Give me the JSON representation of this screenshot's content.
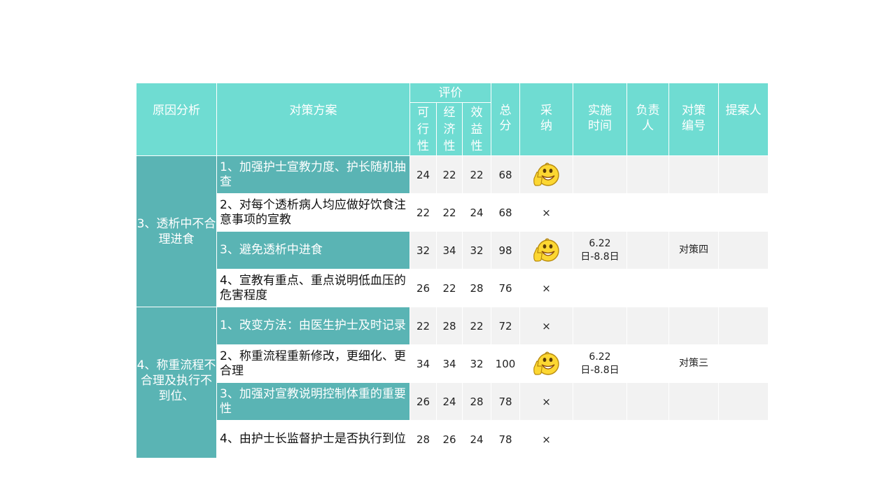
{
  "header": {
    "cause": "原因分析",
    "plan": "对策方案",
    "evaluation": "评价",
    "feasibility": [
      "可",
      "行",
      "性"
    ],
    "economy": [
      "经",
      "济",
      "性"
    ],
    "benefit": [
      "效",
      "益",
      "性"
    ],
    "total": [
      "总",
      "分"
    ],
    "adopt": [
      "采",
      "纳"
    ],
    "time": [
      "实施",
      "时间"
    ],
    "owner": [
      "负责",
      "人"
    ],
    "code": [
      "对策",
      "编号"
    ],
    "proposer": "提案人"
  },
  "causes": [
    {
      "label": "3、透析中不合理进食"
    },
    {
      "label": "4、称重流程不合理及执行不到位、"
    }
  ],
  "rows": [
    {
      "plan": "1、加强护士宣教力度、护长随机抽查",
      "feasibility": "24",
      "economy": "22",
      "benefit": "22",
      "total": "68",
      "adopted": true,
      "adopt_mark": "",
      "time": "",
      "owner": "",
      "code": "",
      "proposer": ""
    },
    {
      "plan": "2、对每个透析病人均应做好饮食注意事项的宣教",
      "feasibility": "22",
      "economy": "22",
      "benefit": "24",
      "total": "68",
      "adopted": false,
      "adopt_mark": "×",
      "time": "",
      "owner": "",
      "code": "",
      "proposer": ""
    },
    {
      "plan": "3、避免透析中进食",
      "feasibility": "32",
      "economy": "34",
      "benefit": "32",
      "total": "98",
      "adopted": true,
      "adopt_mark": "",
      "time": "6.22日-8.8日",
      "owner": "",
      "code": "对策四",
      "proposer": ""
    },
    {
      "plan": "4、宣教有重点、重点说明低血压的危害程度",
      "feasibility": "26",
      "economy": "22",
      "benefit": "28",
      "total": "76",
      "adopted": false,
      "adopt_mark": "×",
      "time": "",
      "owner": "",
      "code": "",
      "proposer": ""
    },
    {
      "plan": "1、改变方法：由医生护士及时记录",
      "feasibility": "22",
      "economy": "28",
      "benefit": "22",
      "total": "72",
      "adopted": false,
      "adopt_mark": "×",
      "time": "",
      "owner": "",
      "code": "",
      "proposer": ""
    },
    {
      "plan": "2、称重流程重新修改，更细化、更合理",
      "feasibility": "34",
      "economy": "34",
      "benefit": "32",
      "total": "100",
      "adopted": true,
      "adopt_mark": "",
      "time": "6.22日-8.8日",
      "owner": "",
      "code": "对策三",
      "proposer": ""
    },
    {
      "plan": "3、加强对宣教说明控制体重的重要性",
      "feasibility": "26",
      "economy": "24",
      "benefit": "28",
      "total": "78",
      "adopted": false,
      "adopt_mark": "×",
      "time": "",
      "owner": "",
      "code": "",
      "proposer": ""
    },
    {
      "plan": "4、由护士长监督护士是否执行到位",
      "feasibility": "28",
      "economy": "26",
      "benefit": "24",
      "total": "78",
      "adopted": false,
      "adopt_mark": "×",
      "time": "",
      "owner": "",
      "code": "",
      "proposer": ""
    }
  ],
  "colors": {
    "header_bg": "#6fdcd2",
    "cause_bg": "#5ab4b4",
    "row_gray": "#f2f2f2",
    "row_white": "#ffffff"
  },
  "icons": {
    "adopted": "smiley-thumbs-up-icon"
  }
}
